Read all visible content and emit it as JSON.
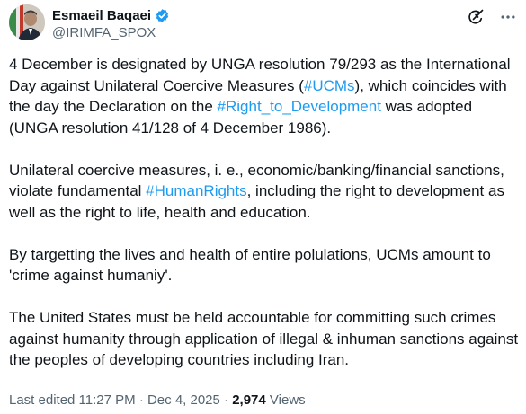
{
  "author": {
    "display_name": "Esmaeil Baqaei",
    "handle": "@IRIMFA_SPOX",
    "verified_icon": "verified-badge-icon",
    "verified_color": "#1d9bf0"
  },
  "actions": {
    "grok_icon": "grok-icon",
    "more_icon": "more-icon"
  },
  "tweet": {
    "p1": {
      "a": "4 December is designated by UNGA resolution 79/293 as the International Day against Unilateral Coercive Measures (",
      "tag1": "#UCMs",
      "b": "), which coincides with the day the Declaration on the ",
      "tag2": "#Right_to_Development",
      "c": " was adopted (UNGA resolution 41/128 of 4 December 1986)."
    },
    "p2": {
      "a": "Unilateral coercive measures, i. e., economic/banking/financial sanctions, violate fundamental ",
      "tag1": "#HumanRights",
      "b": ", including the right to development as well as the right to life, health and education."
    },
    "p3": "By targetting the lives and health of entire polulations, UCMs amount to 'crime against humaniy'.",
    "p4": "The United States must be held accountable for committing such crimes against humanity through application of illegal & inhuman sanctions against the peoples of developing countries including Iran."
  },
  "meta": {
    "edited": "Last edited 11:27 PM · Dec 4, 2025 · ",
    "views_count": "2,974",
    "views_label": " Views"
  },
  "colors": {
    "link": "#1d9bf0",
    "text": "#0f1419",
    "secondary": "#536471"
  }
}
